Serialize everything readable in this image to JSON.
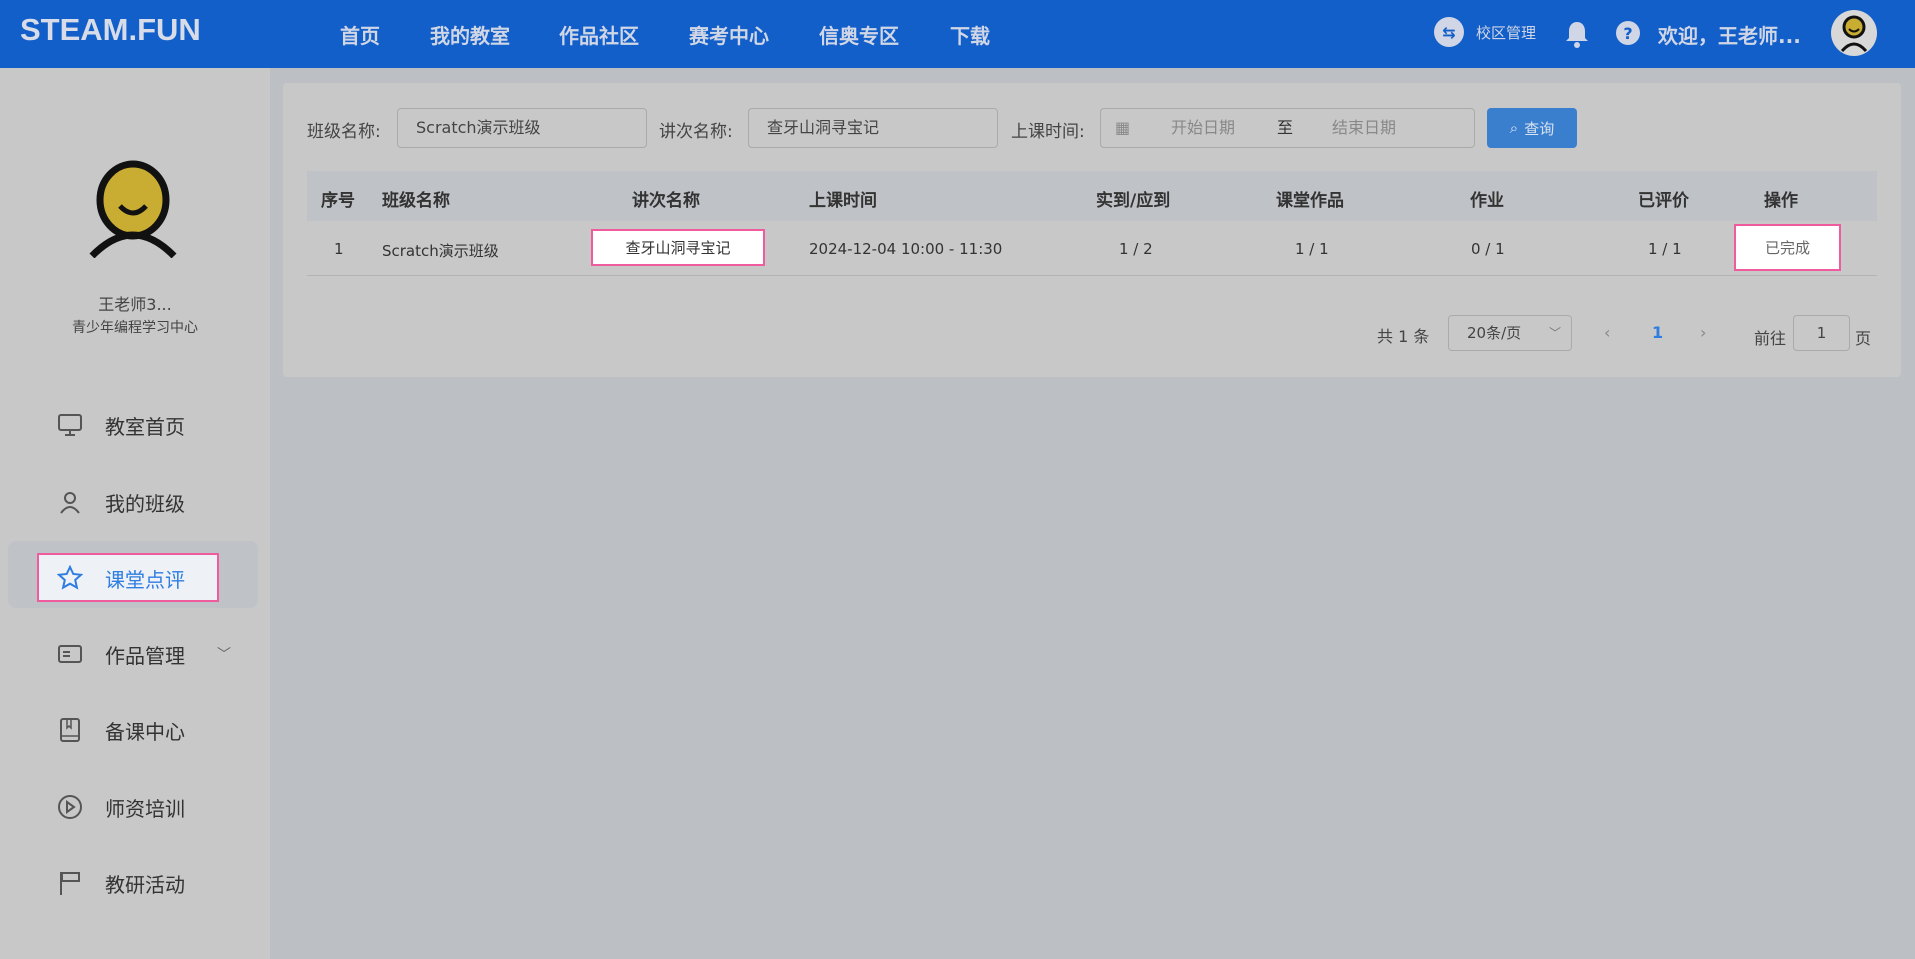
{
  "header": {
    "logo": "STEAM.FUN",
    "nav": [
      "首页",
      "我的教室",
      "作品社区",
      "赛考中心",
      "信奥专区",
      "下载"
    ],
    "campus": "校区管理",
    "welcome": "欢迎，王老师..."
  },
  "sidebar": {
    "user_name": "王老师3...",
    "org": "青少年编程学习中心",
    "items": [
      {
        "label": "教室首页",
        "icon": "monitor-icon"
      },
      {
        "label": "我的班级",
        "icon": "user-icon"
      },
      {
        "label": "课堂点评",
        "icon": "star-icon",
        "active": true
      },
      {
        "label": "作品管理",
        "icon": "card-icon"
      },
      {
        "label": "备课中心",
        "icon": "book-icon"
      },
      {
        "label": "师资培训",
        "icon": "play-icon"
      },
      {
        "label": "教研活动",
        "icon": "flag-icon"
      }
    ]
  },
  "filters": {
    "class_label": "班级名称:",
    "class_value": "Scratch演示班级",
    "lesson_label": "讲次名称:",
    "lesson_value": "查牙山洞寻宝记",
    "time_label": "上课时间:",
    "start_placeholder": "开始日期",
    "to": "至",
    "end_placeholder": "结束日期",
    "query": "查询"
  },
  "table": {
    "headers": [
      "序号",
      "班级名称",
      "讲次名称",
      "上课时间",
      "实到/应到",
      "课堂作品",
      "作业",
      "已评价",
      "操作"
    ],
    "rows": [
      {
        "index": "1",
        "class": "Scratch演示班级",
        "lesson": "查牙山洞寻宝记",
        "time": "2024-12-04 10:00 - 11:30",
        "attendance": "1 / 2",
        "works": "1 / 1",
        "homework": "0 / 1",
        "reviewed": "1 / 1",
        "action": "已完成"
      }
    ]
  },
  "pagination": {
    "total": "共 1 条",
    "page_size": "20条/页",
    "current": "1",
    "goto_label": "前往",
    "goto_value": "1",
    "page_suffix": "页"
  }
}
